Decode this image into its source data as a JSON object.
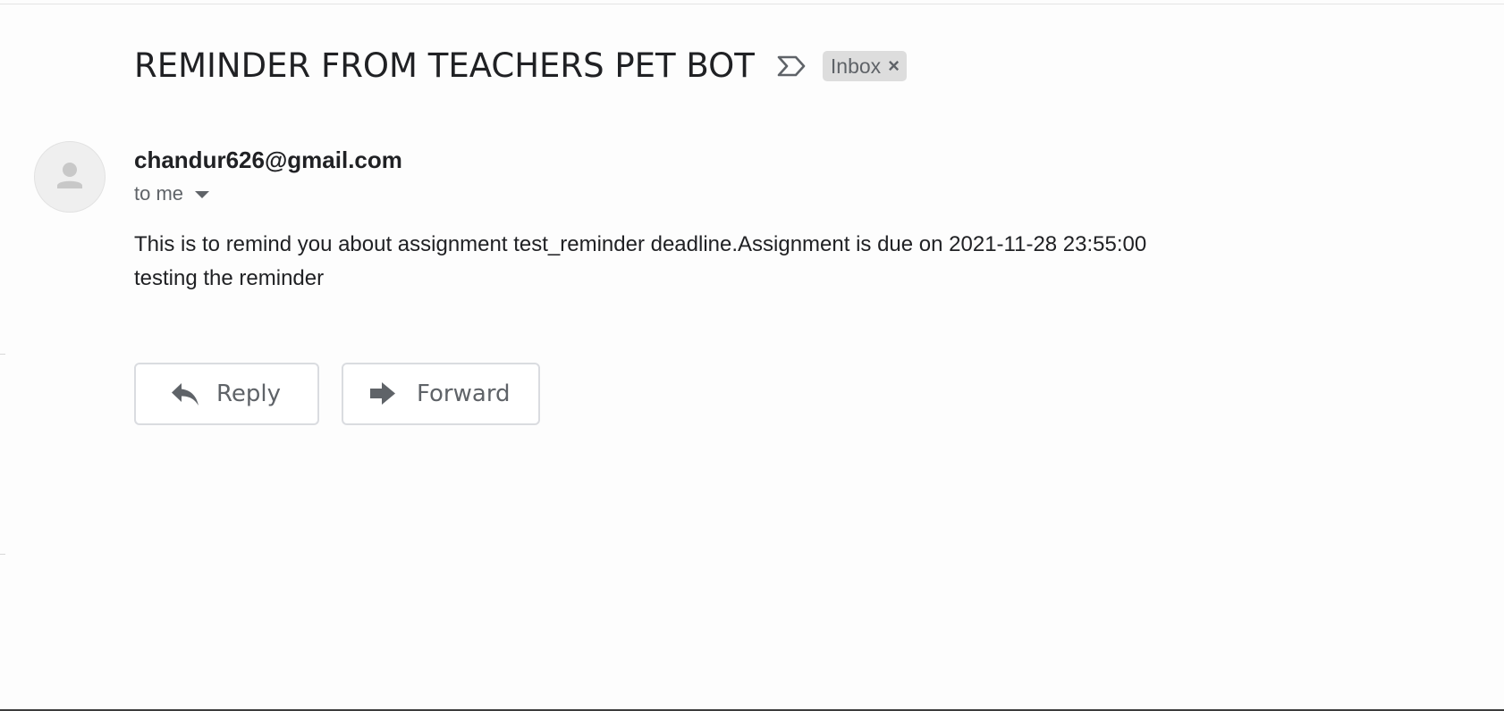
{
  "email": {
    "subject": "REMINDER FROM TEACHERS PET BOT",
    "label_chip": {
      "label": "Inbox",
      "close_glyph": "×"
    },
    "importance_icon": "importance-marker-icon",
    "sender": "chandur626@gmail.com",
    "recipient": "to me",
    "avatar_icon": "person-silhouette-icon",
    "body_lines": [
      "This is to remind you about assignment test_reminder deadline.Assignment is due on 2021-11-28 23:55:00",
      "testing the reminder"
    ]
  },
  "actions": {
    "reply_label": "Reply",
    "reply_icon": "reply-arrow-icon",
    "forward_label": "Forward",
    "forward_icon": "forward-arrow-icon"
  },
  "colors": {
    "background": "#fdfdfd",
    "text_primary": "#202124",
    "text_secondary": "#5f6368",
    "chip_bg": "#dddddd",
    "button_border": "#dadce0"
  }
}
